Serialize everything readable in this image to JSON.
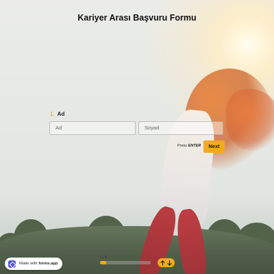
{
  "form": {
    "title": "Kariyer Arası Başvuru Formu",
    "question": {
      "number": "1.",
      "label": "Ad"
    },
    "fields": [
      {
        "placeholder": "Ad"
      },
      {
        "placeholder": "Soyad"
      }
    ],
    "press_hint": {
      "prefix": "Press",
      "key": "ENTER"
    },
    "next_label": "Next"
  },
  "footer": {
    "made_with_prefix": "Made with",
    "made_with_brand": "forms.app",
    "progress_text": "1 / 8",
    "progress_fraction": 0.125,
    "nav_icons": [
      "arrow-up-icon",
      "arrow-down-icon"
    ]
  },
  "colors": {
    "accent": "#f3a923",
    "brand_logo": "#3e59e0"
  }
}
